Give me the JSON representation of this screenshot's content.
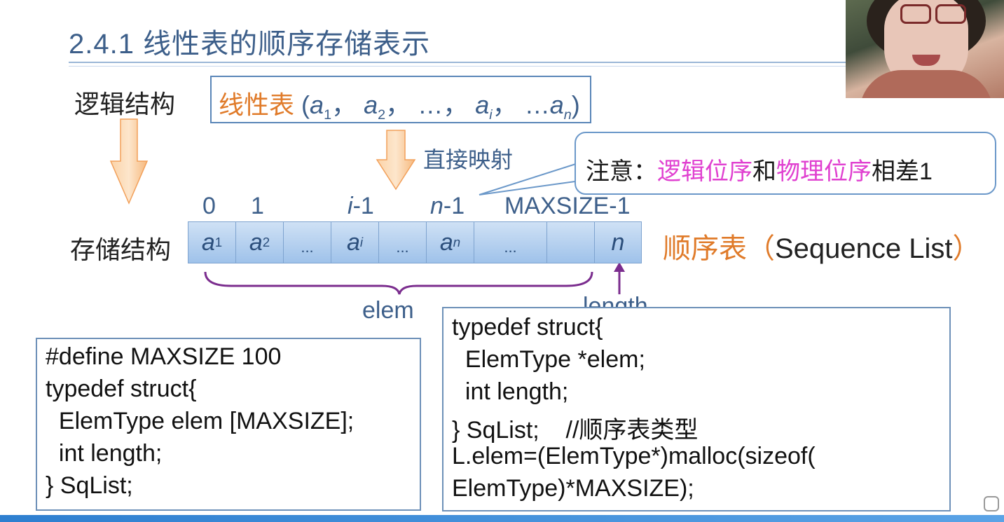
{
  "title": "2.4.1 线性表的顺序存储表示",
  "logic_label": "逻辑结构",
  "storage_label": "存储结构",
  "linear": {
    "name": "线性表",
    "open": "(",
    "sep": "，",
    "ellipsis": "…",
    "ellipsis2": "…",
    "close": ")",
    "a": "a",
    "s1": "1",
    "s2": "2",
    "si": "i",
    "sn": "n"
  },
  "mapping": "直接映射",
  "note": {
    "prefix": "注意：",
    "logic": "逻辑位序",
    "and": "和",
    "physical": "物理位序",
    "suffix": "相差1"
  },
  "indices": {
    "i0": "0",
    "i1": "1",
    "ii": "i",
    "ii_rest": "-1",
    "in": "n",
    "in_rest": "-1",
    "max": "MAXSIZE-1"
  },
  "cells": [
    "a1",
    "a2",
    "...",
    "ai",
    "...",
    "an",
    "...",
    "",
    "n"
  ],
  "cell_parts": {
    "a": "a",
    "s1": "1",
    "s2": "2",
    "si": "i",
    "sn": "n",
    "dots": "...",
    "n": "n"
  },
  "seq_list": {
    "name": "顺序表",
    "open": "（",
    "english": "Sequence List",
    "close": "）"
  },
  "elem_label": "elem",
  "length_label": "length",
  "code_left": [
    "#define MAXSIZE 100",
    "typedef struct{",
    "  ElemType elem [MAXSIZE];",
    "  int length;",
    "} SqList;"
  ],
  "code_right": [
    "typedef struct{",
    "  ElemType *elem;",
    "  int length;",
    "} SqList;    //顺序表类型",
    "L.elem=(ElemType*)malloc(sizeof(",
    "ElemType)*MAXSIZE);"
  ],
  "colors": {
    "accent": "#3d5f8a",
    "orange": "#e07b2a",
    "magenta": "#e040d0",
    "bracket": "#7b2d8e",
    "annotation_red": "#d42020"
  }
}
